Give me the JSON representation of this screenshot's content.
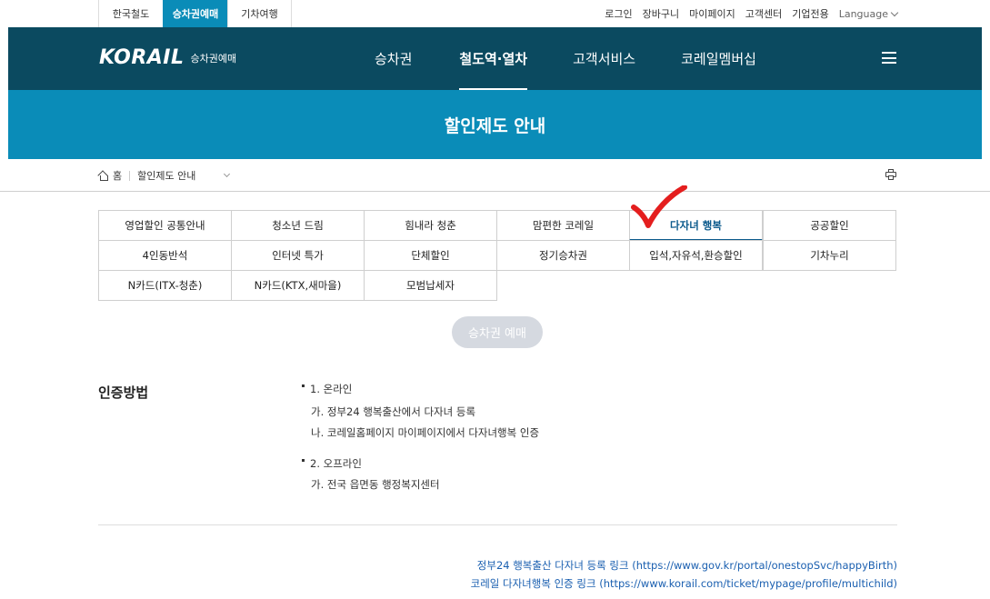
{
  "topbar": {
    "site_tabs": [
      "한국철도",
      "승차권예매",
      "기차여행"
    ],
    "util_links": [
      "로그인",
      "장바구니",
      "마이페이지",
      "고객센터",
      "기업전용"
    ],
    "language": "Language"
  },
  "header": {
    "logo_text": "KORAIL",
    "logo_sub": "승차권예매",
    "menu": [
      "승차권",
      "철도역·열차",
      "고객서비스",
      "코레일멤버십"
    ]
  },
  "banner": {
    "title": "할인제도 안내"
  },
  "breadcrumb": {
    "home": "홈",
    "current": "할인제도 안내"
  },
  "tabs": {
    "row1": [
      "영업할인 공통안내",
      "청소년 드림",
      "힘내라 청춘",
      "맘편한 코레일",
      "다자녀 행복",
      "공공할인"
    ],
    "row2": [
      "4인동반석",
      "인터넷 특가",
      "단체할인",
      "정기승차권",
      "입석,자유석,환승할인",
      "기차누리"
    ],
    "row3": [
      "N카드(ITX-청춘)",
      "N카드(KTX,새마을)",
      "모범납세자"
    ],
    "active": "다자녀 행복"
  },
  "reserve_button": "승차권 예매",
  "section": {
    "title": "인증방법",
    "online_head": "1. 온라인",
    "online_items": [
      "가. 정부24 행복출산에서 다자녀 등록",
      "나. 코레일홈페이지 마이페이지에서 다자녀행복 인증"
    ],
    "offline_head": "2. 오프라인",
    "offline_items": [
      "가. 전국 읍면동 행정복지센터"
    ]
  },
  "links": [
    "정부24 행복출산 다자녀 등록 링크 (https://www.gov.kr/portal/onestopSvc/happyBirth)",
    "코레일 다자녀행복 인증 링크 (https://www.korail.com/ticket/mypage/profile/multichild)"
  ],
  "colors": {
    "nav_bg": "#0b4a60",
    "banner_bg": "#0a8cb8",
    "active_tab": "#0b5a8c",
    "check": "#e41e1e",
    "link": "#1a5fb0"
  }
}
